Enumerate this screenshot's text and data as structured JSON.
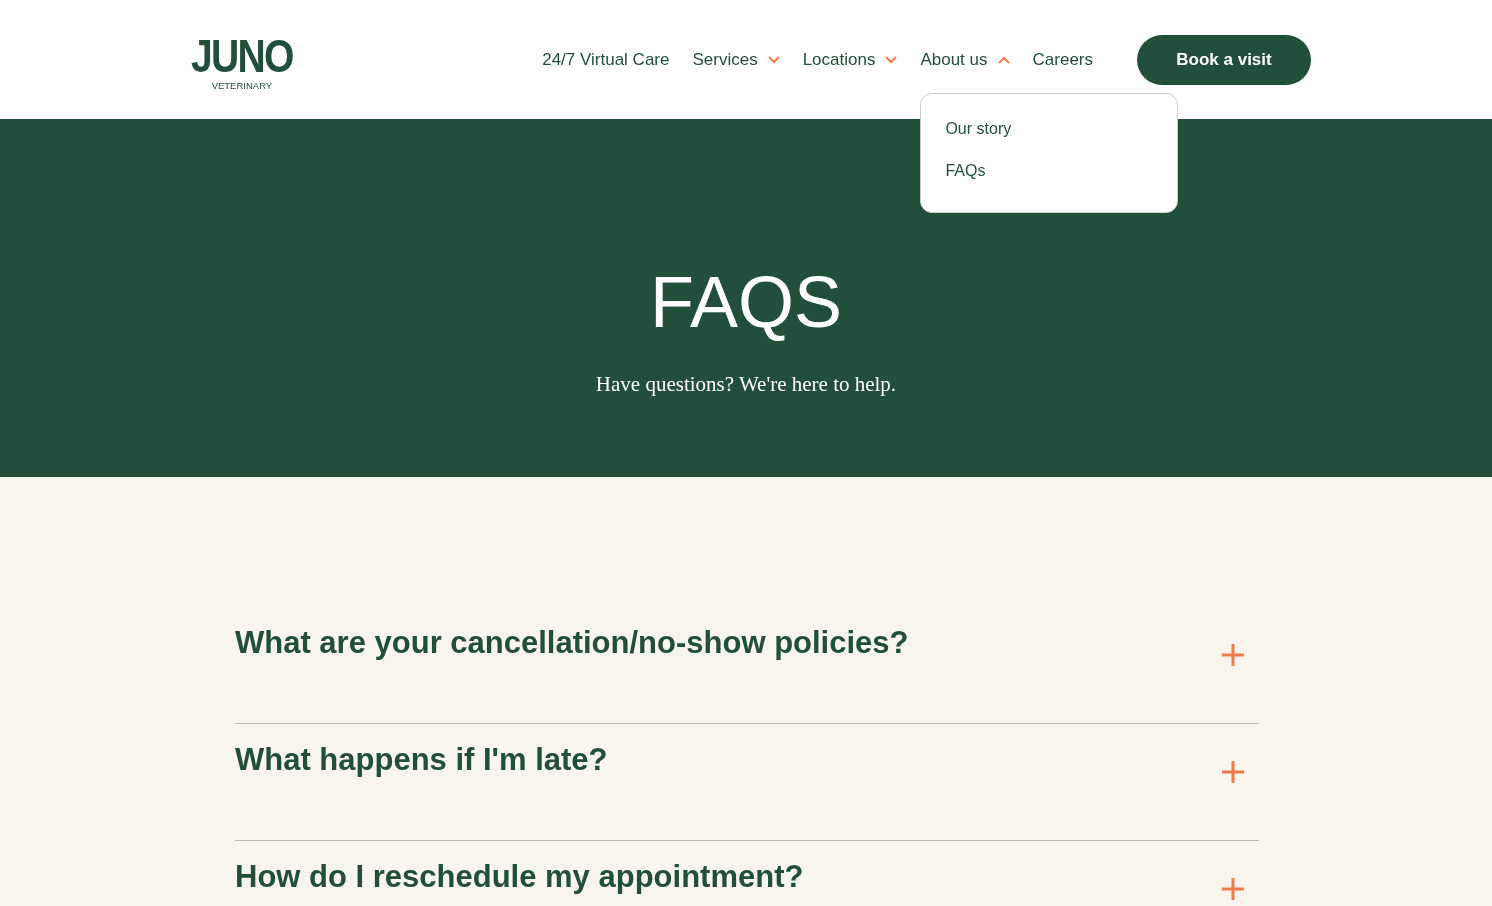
{
  "logo": {
    "wordmark": "JUNO",
    "tagline": "VETERINARY"
  },
  "nav": [
    {
      "label": "24/7 Virtual Care",
      "kind": "link"
    },
    {
      "label": "Services",
      "kind": "dropdown",
      "expanded": false
    },
    {
      "label": "Locations",
      "kind": "dropdown",
      "expanded": false
    },
    {
      "label": "About us",
      "kind": "dropdown",
      "expanded": true,
      "menu": [
        "Our story",
        "FAQs"
      ]
    },
    {
      "label": "Careers",
      "kind": "link"
    }
  ],
  "cta": "Book a visit",
  "hero": {
    "title": "FAQS",
    "subtitle": "Have questions? We're here to help."
  },
  "faqs": [
    {
      "question": "What are your cancellation/no-show policies?",
      "expanded": false
    },
    {
      "question": "What happens if I'm late?",
      "expanded": false
    },
    {
      "question": "How do I reschedule my appointment?",
      "expanded": false
    }
  ]
}
